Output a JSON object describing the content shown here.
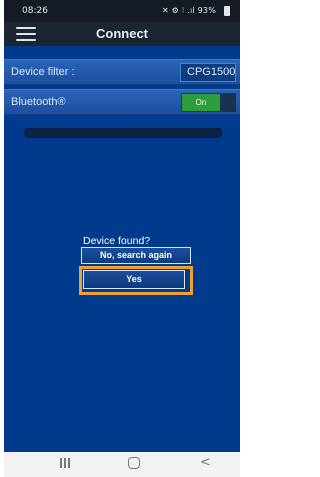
{
  "status_bar": {
    "time": "08:26",
    "indicators": "✕ ⚙ ⁝ .ıl 93%"
  },
  "app_bar": {
    "title": "Connect"
  },
  "device_filter": {
    "label": "Device filter :",
    "value": "CPG1500"
  },
  "bluetooth": {
    "label": "Bluetooth®",
    "toggle_label": "On",
    "enabled": true
  },
  "dialog": {
    "question": "Device found?",
    "search_again_label": "No, search again",
    "yes_label": "Yes"
  },
  "colors": {
    "background": "#003a8c",
    "highlight": "#f0a030",
    "toggle_on": "#2e9e3a"
  }
}
